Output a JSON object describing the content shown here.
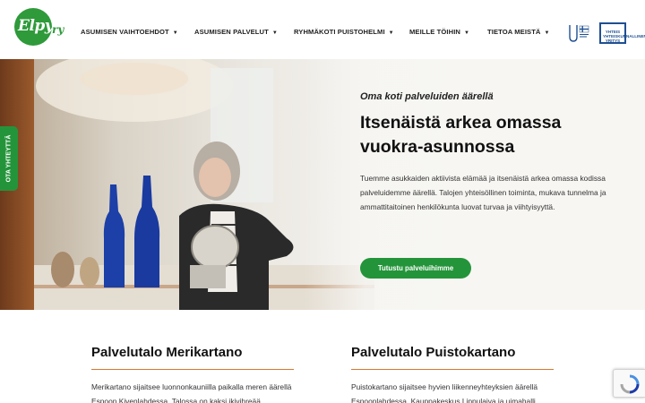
{
  "logo": {
    "text": "Elpy",
    "suffix": "ry",
    "brand_color": "#2e9a3a"
  },
  "nav": {
    "items": [
      {
        "label": "ASUMISEN VAIHTOEHDOT"
      },
      {
        "label": "ASUMISEN PALVELUT"
      },
      {
        "label": "RYHMÄKOTI PUISTOHELMI"
      },
      {
        "label": "MEILLE TÖIHIN"
      },
      {
        "label": "TIETOA MEISTÄ"
      }
    ],
    "caret_icon": "caret-down-icon"
  },
  "badges": {
    "first_icon": "finland-flag-badge-icon",
    "second": {
      "text": "YHTEIS YHTEISKUNNALLINEN YRITYS",
      "color": "#1f4f92"
    }
  },
  "hero": {
    "subtitle": "Oma koti palveluiden äärellä",
    "title": "Itsenäistä arkea omassa vuokra-asunnossa",
    "text": "Tuemme asukkaiden aktiivista elämää ja itsenäistä arkea omassa kodissa palveluidemme äärellä. Talojen yhteisöllinen toiminta, mukava tunnelma ja ammattitaitoinen henkilökunta luovat turvaa ja viihtyisyyttä.",
    "button_label": "Tutustu palveluihimme",
    "accent_color": "#24943a"
  },
  "side_tab": {
    "label": "OTA YHTEYTTÄ"
  },
  "cards": [
    {
      "title": "Palvelutalo Merikartano",
      "text": "Merikartano sijaitsee luonnonkauniilla paikalla meren äärellä Espoon Kivenlahdessa. Talossa on kaksi ikivihreää"
    },
    {
      "title": "Palvelutalo Puistokartano",
      "text": "Puistokartano sijaitsee hyvien liikenneyhteyksien äärellä Espoonlahdessa. Kauppakeskus Lippulaiva ja uimahalli"
    }
  ],
  "recaptcha": {
    "icon": "recaptcha-icon"
  },
  "colors": {
    "divider": "#d8782e"
  }
}
